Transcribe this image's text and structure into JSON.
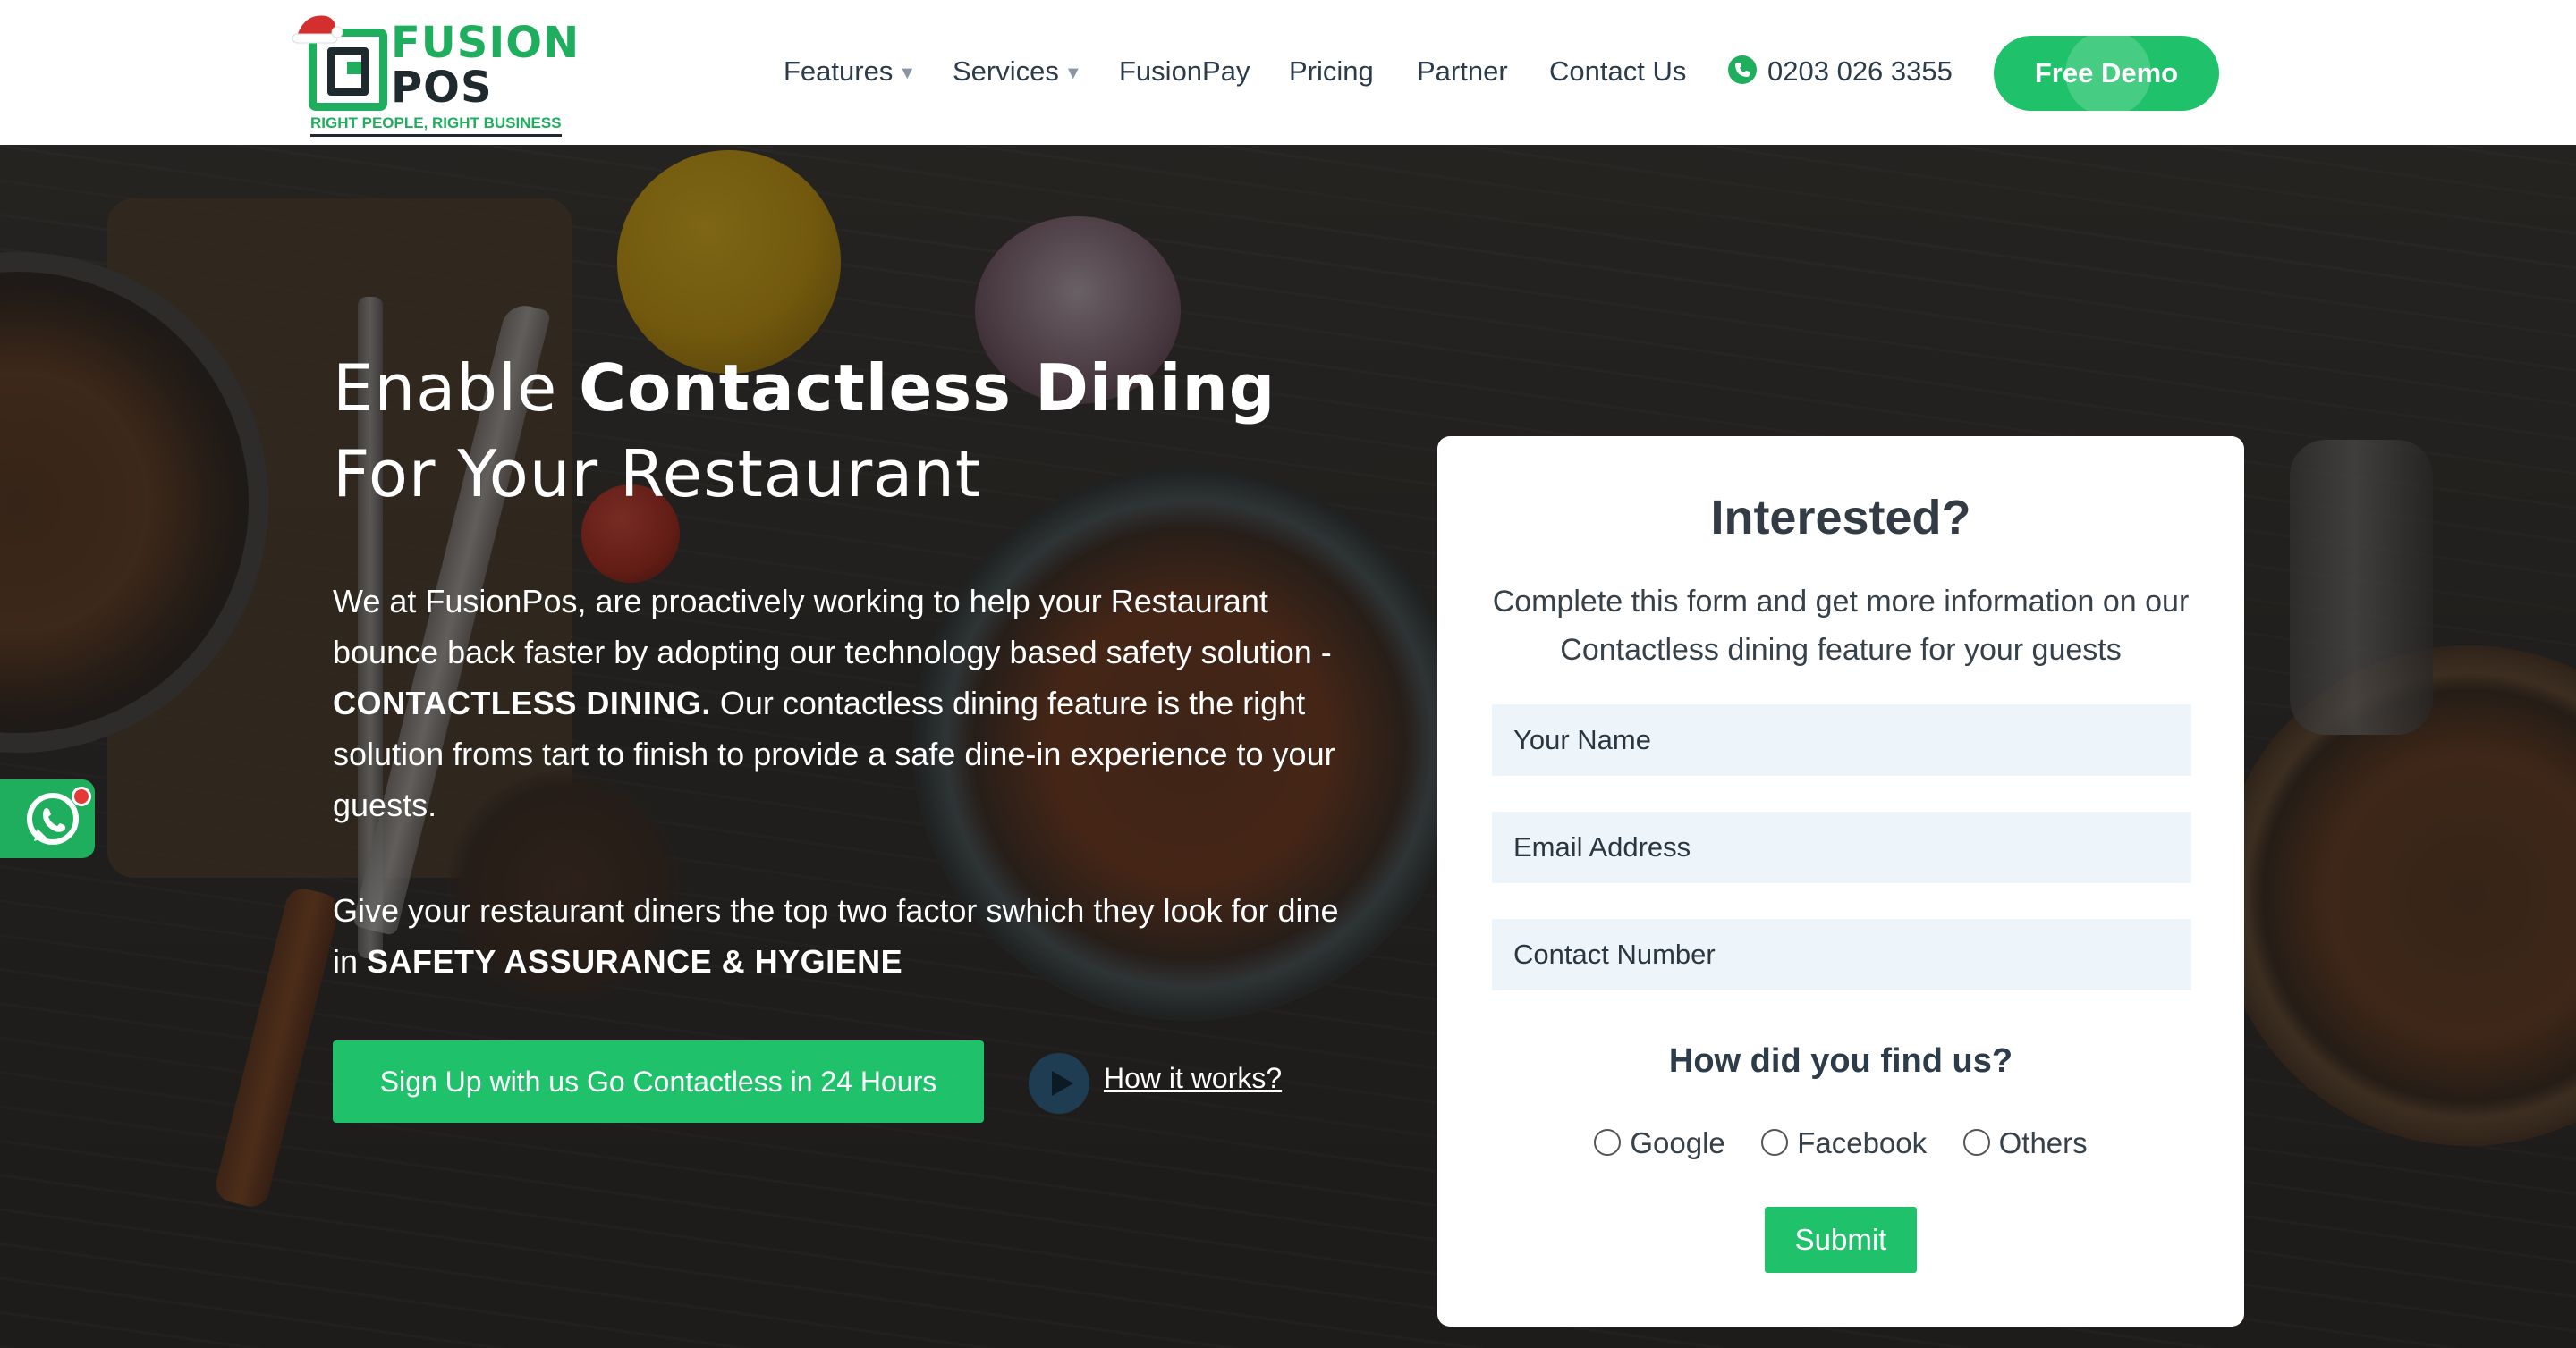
{
  "brand": {
    "name_line1": "FUSION",
    "name_line2": "POS",
    "tagline": "RIGHT PEOPLE, RIGHT BUSINESS",
    "primary_color": "#1fc16a",
    "dark_color": "#1f2a2f"
  },
  "nav": {
    "items": [
      {
        "label": "Features",
        "dropdown": true
      },
      {
        "label": "Services",
        "dropdown": true
      },
      {
        "label": "FusionPay",
        "dropdown": false
      },
      {
        "label": "Pricing",
        "dropdown": false
      },
      {
        "label": "Partner",
        "dropdown": false
      },
      {
        "label": "Contact Us",
        "dropdown": false
      }
    ],
    "phone": "0203 026 3355",
    "phone_icon": "phone-icon",
    "cta": "Free Demo"
  },
  "hero": {
    "title_light_1": "Enable ",
    "title_bold": "Contactless Dining",
    "title_light_2": "For Your Restaurant",
    "para1_a": "We at FusionPos, are proactively working to help your Restaurant bounce back faster by adopting our technology based safety solution - ",
    "para1_b": "CONTACTLESS DINING.",
    "para1_c": " Our contactless dining feature is the right solution froms tart to finish to provide a safe dine-in experience to your guests.",
    "para2_a": "Give your restaurant diners the top two factor swhich they look for dine in ",
    "para2_b": "SAFETY ASSURANCE & HYGIENE",
    "signup_label": "Sign Up with us Go Contactless in 24 Hours",
    "how_label": "How it works?"
  },
  "form": {
    "title": "Interested?",
    "subtitle": "Complete this form and get more information on our Contactless dining feature for your guests",
    "name_placeholder": "Your Name",
    "email_placeholder": "Email Address",
    "contact_placeholder": "Contact Number",
    "find_title": "How did you find us?",
    "options": [
      "Google",
      "Facebook",
      "Others"
    ],
    "submit_label": "Submit"
  },
  "widgets": {
    "whatsapp_icon": "whatsapp-icon"
  }
}
